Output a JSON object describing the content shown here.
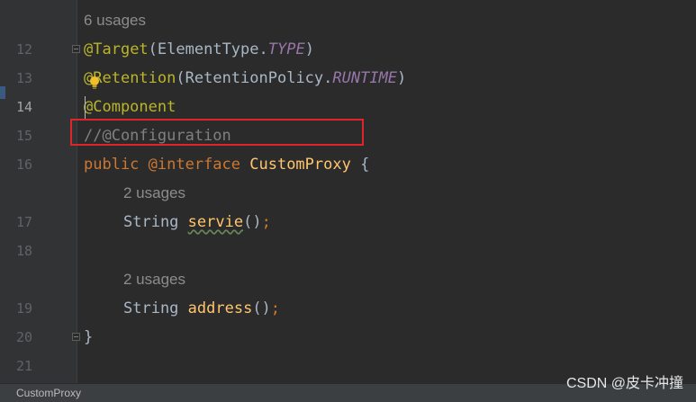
{
  "editor": {
    "usages_top": "6 usages",
    "usages_servie": "2 usages",
    "usages_address": "2 usages",
    "line_numbers": [
      "12",
      "13",
      "14",
      "15",
      "16",
      "17",
      "18",
      "19",
      "20",
      "21"
    ],
    "line12": {
      "at": "@",
      "ann": "Target",
      "open": "(",
      "cls": "ElementType.",
      "const": "TYPE",
      "close": ")"
    },
    "line13": {
      "at": "@",
      "ann": "Retention",
      "open": "(",
      "cls": "RetentionPolicy.",
      "const": "RUNTIME",
      "close": ")"
    },
    "line14": {
      "ann": "@Component"
    },
    "line15": {
      "comment": "//@Configuration"
    },
    "line16": {
      "kw_public": "public ",
      "kw_interface": "@interface ",
      "name": "CustomProxy",
      "brace": " {"
    },
    "line17": {
      "type": "String ",
      "method": "servie",
      "parens": "()",
      "semi": ";"
    },
    "line19": {
      "type": "String ",
      "method": "address",
      "parens": "()",
      "semi": ";"
    },
    "line20": {
      "brace": "}"
    }
  },
  "statusbar": {
    "breadcrumb": "CustomProxy"
  },
  "watermark": "CSDN @皮卡冲撞",
  "colors": {
    "annotation": "#bbb529",
    "keyword": "#cc7832",
    "method": "#ffc66d",
    "constant": "#9876aa",
    "comment": "#808080",
    "highlight_box": "#e0242c"
  }
}
